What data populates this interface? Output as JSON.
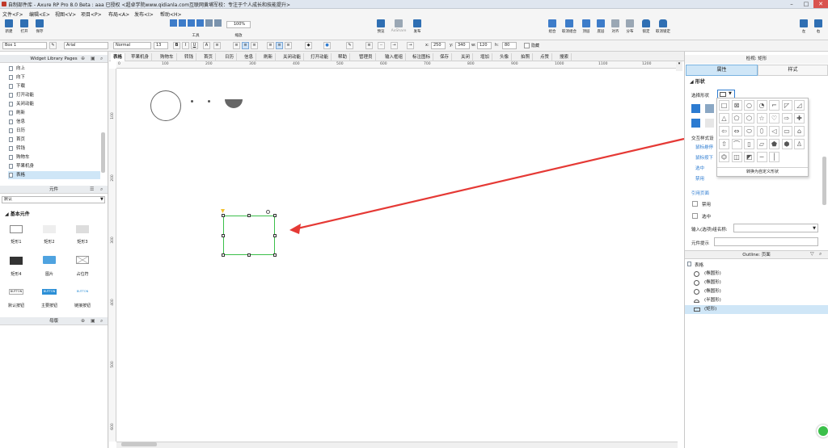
{
  "window": {
    "title": "自制部件库 - Axure RP Pro 8.0 Beta : aaa 已授权 <超卓学院www.qidianla.com互联网黄埔军校：专注于个人成长和技能提升>"
  },
  "menu": [
    "文件<F>",
    "编辑<E>",
    "视图<V>",
    "项目<P>",
    "布局<A>",
    "发布<I>",
    "帮助<H>"
  ],
  "toolbar": {
    "buttons": [
      "新建",
      "打开",
      "保存"
    ],
    "tools_label": "工具",
    "zoom_label": "缩放",
    "zoom_value": "100%",
    "preview": "预览",
    "share": "AxShare",
    "publish": "发布",
    "right_buttons": [
      "组合",
      "取消组合",
      "顶层",
      "底层",
      "对齐",
      "分布",
      "锁定",
      "取消锁定"
    ],
    "mode_left": "左",
    "mode_right": "右"
  },
  "format": {
    "widget": "Box 1",
    "font": "Arial",
    "style": "Normal",
    "size": "13",
    "x_label": "x:",
    "x": "250",
    "y_label": "y:",
    "y": "340",
    "w_label": "w:",
    "w": "120",
    "h_label": "h:",
    "h": "80",
    "hidden": "隐藏"
  },
  "pages_panel": {
    "title": "Widget Library Pages",
    "items": [
      "向上",
      "向下",
      "下载",
      "打开动能",
      "关闭动能",
      "刷新",
      "信息",
      "日历",
      "首页",
      "转钱",
      "购物车",
      "苹果机身",
      "表格"
    ],
    "selected": "表格"
  },
  "widgets_panel": {
    "title": "元件",
    "library": "默认",
    "section": "基本元件",
    "items": [
      "矩形1",
      "矩形2",
      "矩形3",
      "矩形4",
      "图片",
      "占位符",
      "默认按钮",
      "主要按钮",
      "链接按钮"
    ],
    "button_text": "BUTTON"
  },
  "masters_panel": {
    "title": "母版"
  },
  "page_tabs": [
    "表格",
    "苹果机身",
    "购物车",
    "转钱",
    "首页",
    "日历",
    "信息",
    "刷新",
    "关闭动能",
    "打开动能",
    "帮助",
    "管理员",
    "输入框组",
    "标注图标",
    "保存",
    "关闭",
    "增加",
    "头像",
    "拍照",
    "点赞",
    "搜索"
  ],
  "ruler": {
    "h": [
      "0",
      "100",
      "200",
      "300",
      "400",
      "500",
      "600",
      "700",
      "800",
      "900",
      "1000",
      "1100",
      "1200"
    ],
    "v": [
      "100",
      "200",
      "300",
      "400",
      "500",
      "600"
    ]
  },
  "inspector": {
    "title": "检视: 矩形",
    "tab_props": "属性",
    "tab_style": "样式",
    "section_shape": "形状",
    "select_shape": "选择形状",
    "interaction_styles": "交互样式设",
    "links": [
      "鼠标悬停",
      "鼠标按下",
      "选中",
      "禁用"
    ],
    "ref_page": "引用页面",
    "disabled": "禁用",
    "selected": "选中",
    "input_group": "输入(选项)组名称:",
    "tooltip": "元件提示",
    "convert_custom": "转换为自定义形状"
  },
  "outline": {
    "title": "Outline: 页面",
    "root": "表格",
    "items": [
      "(椭圆形)",
      "(椭圆形)",
      "(椭圆形)",
      "(半圆形)",
      "(矩形)"
    ],
    "selected_index": 4
  },
  "colors": {
    "accent": "#2c7bd1",
    "selection": "#cfe6f7",
    "arrow": "#e53935",
    "shape_border": "#3bbf4a"
  }
}
